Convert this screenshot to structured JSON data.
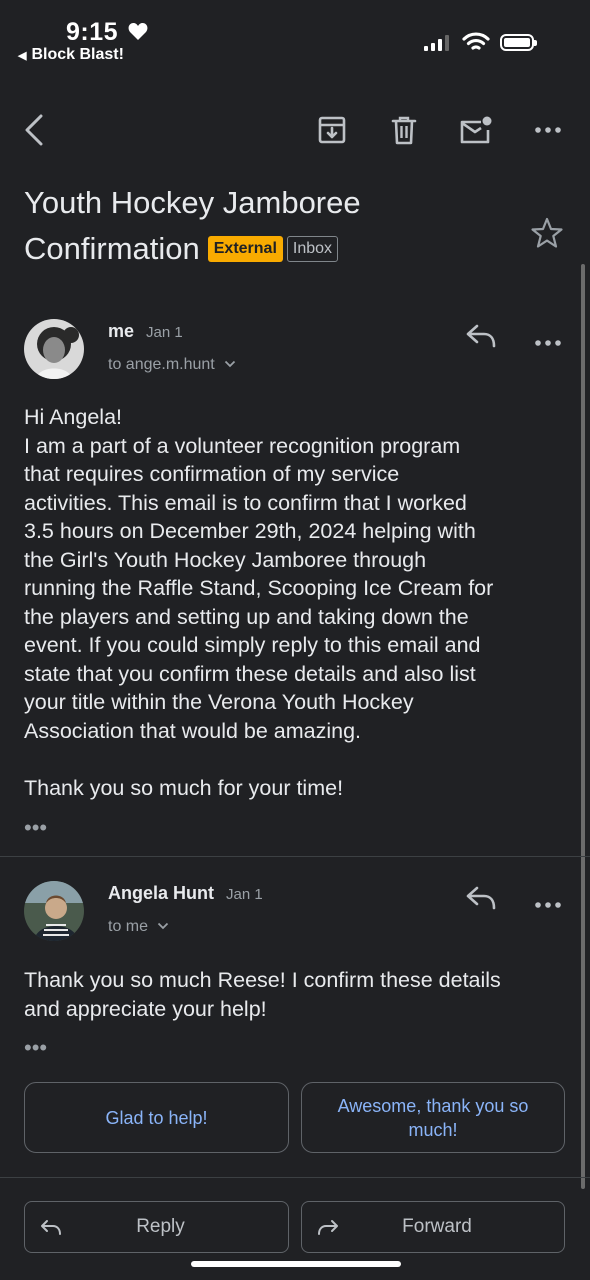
{
  "status_bar": {
    "time": "9:15",
    "back_app": "Block Blast!",
    "icons": [
      "heart-icon",
      "cellular-signal-icon",
      "wifi-icon",
      "battery-icon"
    ]
  },
  "toolbar": {
    "icons": [
      "back-arrow-icon",
      "archive-icon",
      "delete-icon",
      "mark-unread-icon",
      "more-icon"
    ]
  },
  "email": {
    "subject": "Youth Hockey Jamboree Confirmation",
    "labels": {
      "external": "External",
      "inbox": "Inbox"
    }
  },
  "messages": [
    {
      "sender": "me",
      "date": "Jan 1",
      "to": "to ange.m.hunt",
      "body_lines": [
        "Hi Angela!",
        "I am a part of a volunteer recognition program",
        "that requires confirmation of my service",
        "activities. This email is to confirm that I worked",
        "3.5 hours on December 29th, 2024 helping with",
        "the Girl's Youth Hockey Jamboree through",
        "running the Raffle Stand, Scooping Ice Cream for",
        "the players and setting up and taking down the",
        "event. If you could simply reply to this email and",
        "state that you confirm these details and also list",
        "your title within  the Verona Youth Hockey",
        "Association that would be amazing.",
        "",
        "Thank you so much for your time!"
      ],
      "ellipsis": "•••"
    },
    {
      "sender": "Angela Hunt",
      "date": "Jan 1",
      "to": "to me",
      "body_lines": [
        "Thank you so much Reese! I confirm these details",
        "and appreciate your help!"
      ],
      "ellipsis": "•••"
    }
  ],
  "smart_replies": [
    "Glad to help!",
    "Awesome, thank you so much!"
  ],
  "actions": {
    "reply": "Reply",
    "forward": "Forward"
  },
  "colors": {
    "background": "#202124",
    "external_badge": "#f9ab00",
    "link_blue": "#8ab4f8"
  }
}
